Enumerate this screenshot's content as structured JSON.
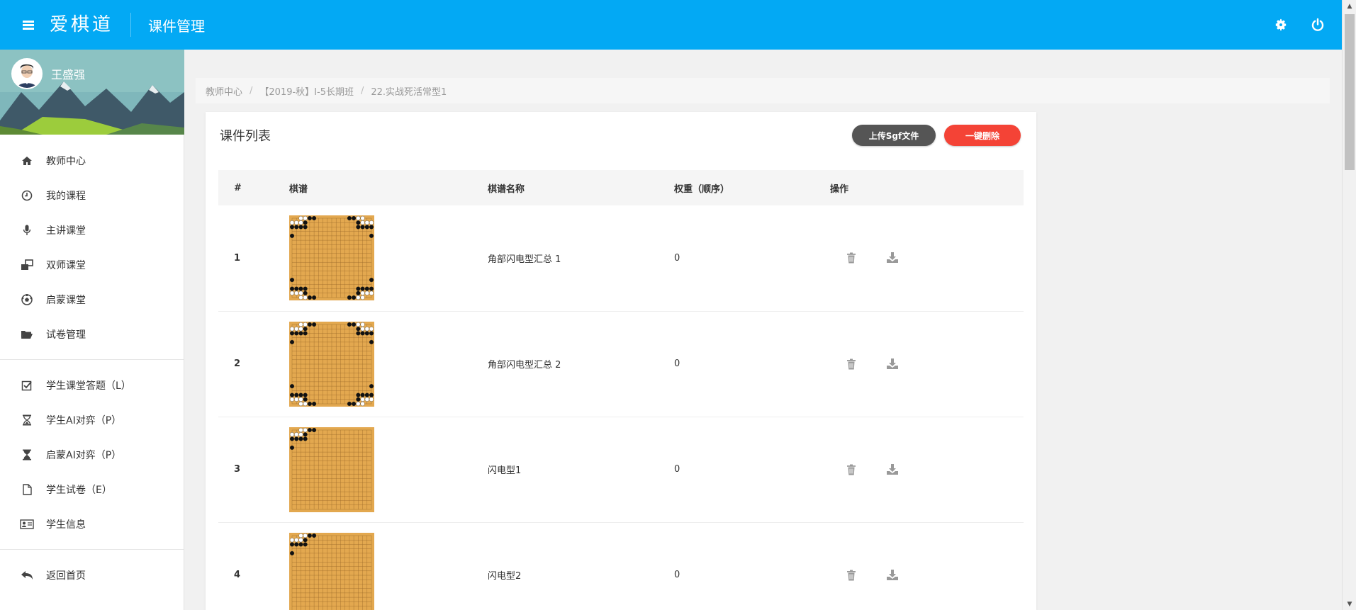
{
  "header": {
    "brand": "爱棋道",
    "title": "课件管理"
  },
  "sidebar": {
    "user_name": "王盛强",
    "groups": [
      [
        {
          "label": "教师中心",
          "icon": "home-icon"
        },
        {
          "label": "我的课程",
          "icon": "clock-icon"
        },
        {
          "label": "主讲课堂",
          "icon": "microphone-icon"
        },
        {
          "label": "双师课堂",
          "icon": "windows-icon"
        },
        {
          "label": "启蒙课堂",
          "icon": "soccer-ball-icon"
        },
        {
          "label": "试卷管理",
          "icon": "folder-open-icon"
        }
      ],
      [
        {
          "label": "学生课堂答题（L）",
          "icon": "checkbox-icon"
        },
        {
          "label": "学生AI对弈（P）",
          "icon": "hourglass-icon"
        },
        {
          "label": "启蒙AI对弈（P）",
          "icon": "hourglass-icon"
        },
        {
          "label": "学生试卷（E）",
          "icon": "file-icon"
        },
        {
          "label": "学生信息",
          "icon": "id-card-icon"
        }
      ],
      [
        {
          "label": "返回首页",
          "icon": "reply-icon"
        }
      ]
    ]
  },
  "breadcrumb": [
    "教师中心",
    "【2019-秋】I-5长期班",
    "22.实战死活常型1"
  ],
  "card": {
    "title": "课件列表",
    "upload_button": "上传Sgf文件",
    "delete_all_button": "一键删除"
  },
  "table": {
    "headers": [
      "#",
      "棋谱",
      "棋谱名称",
      "权重（顺序）",
      "操作"
    ],
    "rows": [
      {
        "index": "1",
        "name": "角部闪电型汇总 1",
        "weight": "0",
        "board": "board-four-corners"
      },
      {
        "index": "2",
        "name": "角部闪电型汇总 2",
        "weight": "0",
        "board": "board-four-corners"
      },
      {
        "index": "3",
        "name": "闪电型1",
        "weight": "0",
        "board": "board-top-left-corner"
      },
      {
        "index": "4",
        "name": "闪电型2",
        "weight": "0",
        "board": "board-top-left-corner"
      }
    ]
  },
  "colors": {
    "topbar": "#03a9f4",
    "upload_button": "#555555",
    "delete_button": "#f44336",
    "board": "#e3a84f"
  }
}
